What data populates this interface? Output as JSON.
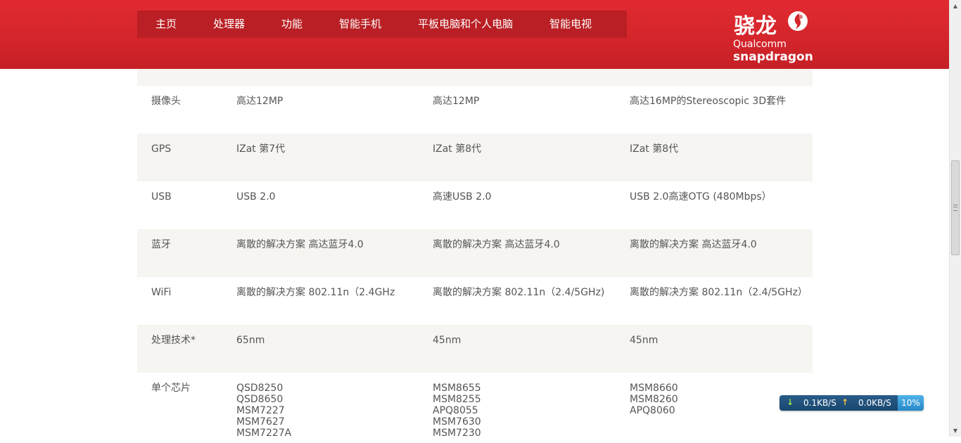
{
  "nav": {
    "items": [
      {
        "label": "主页"
      },
      {
        "label": "处理器"
      },
      {
        "label": "功能"
      },
      {
        "label": "智能手机"
      },
      {
        "label": "平板电脑和个人电脑"
      },
      {
        "label": "智能电视"
      }
    ]
  },
  "logo": {
    "chinese": "骁龙",
    "brand": "Qualcomm",
    "product": "snapdragon"
  },
  "spec_rows": [
    {
      "label": "摄像头",
      "cols": [
        "高达12MP",
        "高达12MP",
        "高达16MP的Stereoscopic 3D套件"
      ]
    },
    {
      "label": "GPS",
      "cols": [
        "IZat 第7代",
        "IZat 第8代",
        "IZat 第8代"
      ]
    },
    {
      "label": "USB",
      "cols": [
        "USB 2.0",
        "高速USB 2.0",
        "USB 2.0高速OTG (480Mbps）"
      ]
    },
    {
      "label": "蓝牙",
      "cols": [
        "离散的解决方案 高达蓝牙4.0",
        "离散的解决方案 高达蓝牙4.0",
        "离散的解决方案 高达蓝牙4.0"
      ]
    },
    {
      "label": "WiFi",
      "cols": [
        "离散的解决方案 802.11n（2.4GHz",
        "离散的解决方案 802.11n（2.4/5GHz)",
        "离散的解决方案 802.11n（2.4/5GHz）"
      ]
    },
    {
      "label": "处理技术*",
      "cols": [
        "65nm",
        "45nm",
        "45nm"
      ]
    }
  ],
  "chip_row": {
    "label": "单个芯片",
    "col1": [
      "QSD8250",
      "QSD8650",
      "MSM7227",
      "MSM7627",
      "MSM7227A"
    ],
    "col2": [
      "MSM8655",
      "MSM8255",
      "APQ8055",
      "MSM7630",
      "MSM7230"
    ],
    "col3": [
      "MSM8660",
      "MSM8260",
      "APQ8060"
    ]
  },
  "netmon": {
    "download": "0.1KB/S",
    "upload": "0.0KB/S",
    "percent": "10%"
  },
  "colors": {
    "header_red": "#d3252b",
    "nav_bg": "#b91f24",
    "row_shade": "#f6f5f1"
  }
}
